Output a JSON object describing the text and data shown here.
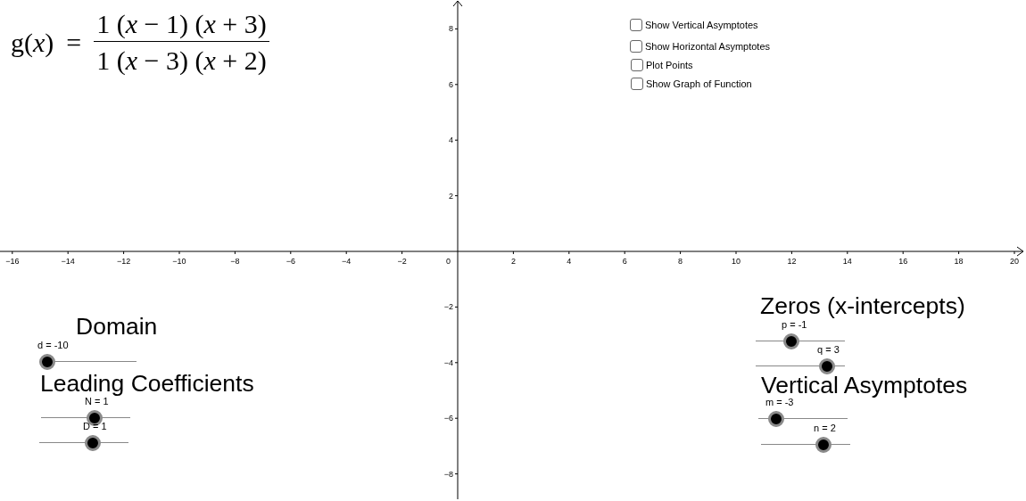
{
  "formula": {
    "lhs": "g(*x*)",
    "equals": "=",
    "numerator": "1 (*x* − 1) (*x* + 3)",
    "denominator": "1 (*x* − 3) (*x* + 2)"
  },
  "checkboxes": [
    {
      "label": "Show Vertical Asymptotes",
      "checked": false
    },
    {
      "label": "Show Horizontal Asymptotes",
      "checked": false
    },
    {
      "label": "Plot Points",
      "checked": false
    },
    {
      "label": "Show Graph of Function",
      "checked": false
    }
  ],
  "axes": {
    "origin": "0",
    "x_ticks": [
      "−16",
      "−14",
      "−12",
      "−10",
      "−8",
      "−6",
      "−4",
      "−2",
      "2",
      "4",
      "6",
      "8",
      "10",
      "12",
      "14",
      "16",
      "18",
      "20"
    ],
    "y_ticks": [
      "8",
      "6",
      "4",
      "2",
      "−2",
      "−4",
      "−6",
      "−8"
    ]
  },
  "headings": [
    "Domain",
    "Leading Coefficients",
    "Zeros (x-intercepts)",
    "Vertical Asymptotes"
  ],
  "sliders": [
    {
      "label": "d = -10",
      "level": 0
    },
    {
      "label": "N = 1",
      "level": 0.6
    },
    {
      "label": "D = 1",
      "level": 0.6
    },
    {
      "label": "p = -1",
      "level": 0.4
    },
    {
      "label": "q = 3",
      "level": 0.8
    },
    {
      "label": "m = -3",
      "level": 0.2
    },
    {
      "label": "n = 2",
      "level": 0.7
    }
  ]
}
